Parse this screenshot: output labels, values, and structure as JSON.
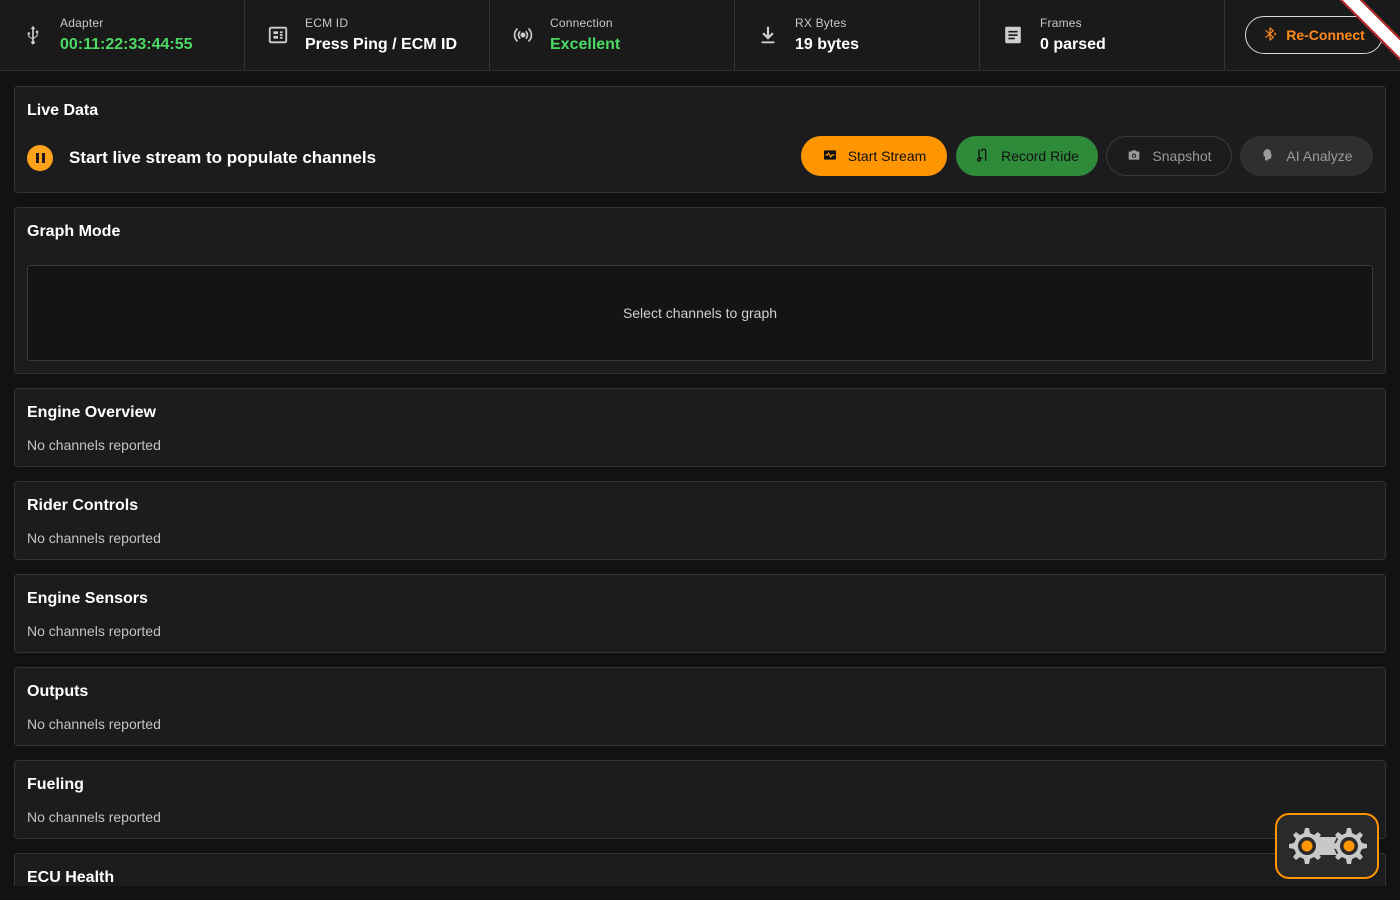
{
  "status_bar": {
    "adapter": {
      "label": "Adapter",
      "value": "00:11:22:33:44:55",
      "icon": "usb-icon"
    },
    "ecm_id": {
      "label": "ECM ID",
      "value": "Press Ping / ECM ID",
      "icon": "chip-icon"
    },
    "connection": {
      "label": "Connection",
      "value": "Excellent",
      "icon": "signal-icon"
    },
    "rx_bytes": {
      "label": "RX Bytes",
      "value": "19 bytes",
      "icon": "download-icon"
    },
    "frames": {
      "label": "Frames",
      "value": "0 parsed",
      "icon": "document-icon"
    },
    "reconnect_label": "Re-Connect"
  },
  "live_data": {
    "title": "Live Data",
    "status_message": "Start live stream to populate channels",
    "buttons": {
      "start_stream": "Start Stream",
      "record_ride": "Record Ride",
      "snapshot": "Snapshot",
      "ai_analyze": "AI Analyze"
    }
  },
  "graph_mode": {
    "title": "Graph Mode",
    "empty_message": "Select channels to graph"
  },
  "sections": [
    {
      "title": "Engine Overview",
      "message": "No channels reported"
    },
    {
      "title": "Rider Controls",
      "message": "No channels reported"
    },
    {
      "title": "Engine Sensors",
      "message": "No channels reported"
    },
    {
      "title": "Outputs",
      "message": "No channels reported"
    },
    {
      "title": "Fueling",
      "message": "No channels reported"
    },
    {
      "title": "ECU Health",
      "message": ""
    }
  ],
  "colors": {
    "accent": "#ff9500",
    "success": "#4cd964",
    "record": "#2e8b3a",
    "background": "#121212",
    "panel": "#1c1c1e"
  }
}
